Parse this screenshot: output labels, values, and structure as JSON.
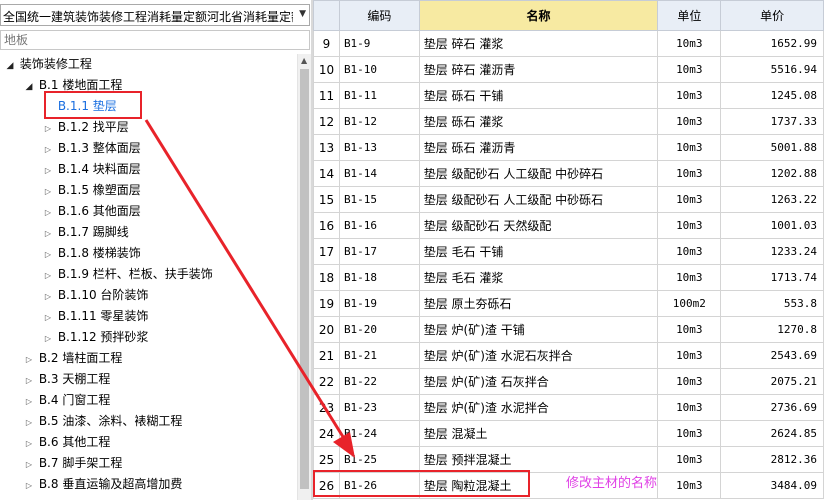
{
  "quota_library": "全国统一建筑装饰装修工程消耗量定额河北省消耗量定额",
  "search": {
    "placeholder": "地板"
  },
  "tree": [
    {
      "label": "装饰装修工程",
      "expanded": true
    },
    {
      "label": "B.1  楼地面工程",
      "expanded": true
    },
    {
      "label": "B.1.1  垫层",
      "selected": true
    },
    {
      "label": "B.1.2  找平层"
    },
    {
      "label": "B.1.3  整体面层"
    },
    {
      "label": "B.1.4  块料面层"
    },
    {
      "label": "B.1.5  橡塑面层"
    },
    {
      "label": "B.1.6  其他面层"
    },
    {
      "label": "B.1.7  踢脚线"
    },
    {
      "label": "B.1.8  楼梯装饰"
    },
    {
      "label": "B.1.9  栏杆、栏板、扶手装饰"
    },
    {
      "label": "B.1.10  台阶装饰"
    },
    {
      "label": "B.1.11  零星装饰"
    },
    {
      "label": "B.1.12  预拌砂浆"
    },
    {
      "label": "B.2  墙柱面工程"
    },
    {
      "label": "B.3  天棚工程"
    },
    {
      "label": "B.4  门窗工程"
    },
    {
      "label": "B.5  油漆、涂料、裱糊工程"
    },
    {
      "label": "B.6  其他工程"
    },
    {
      "label": "B.7  脚手架工程"
    },
    {
      "label": "B.8  垂直运输及超高增加费"
    }
  ],
  "table": {
    "headers": {
      "num": "",
      "code": "编码",
      "name": "名称",
      "unit": "单位",
      "price": "单价"
    },
    "rows": [
      {
        "n": "9",
        "code": "B1-9",
        "name": "垫层 碎石 灌浆",
        "unit": "10m3",
        "price": "1652.99"
      },
      {
        "n": "10",
        "code": "B1-10",
        "name": "垫层 碎石 灌沥青",
        "unit": "10m3",
        "price": "5516.94"
      },
      {
        "n": "11",
        "code": "B1-11",
        "name": "垫层 砾石 干铺",
        "unit": "10m3",
        "price": "1245.08"
      },
      {
        "n": "12",
        "code": "B1-12",
        "name": "垫层 砾石 灌浆",
        "unit": "10m3",
        "price": "1737.33"
      },
      {
        "n": "13",
        "code": "B1-13",
        "name": "垫层 砾石 灌沥青",
        "unit": "10m3",
        "price": "5001.88"
      },
      {
        "n": "14",
        "code": "B1-14",
        "name": "垫层 级配砂石 人工级配 中砂碎石",
        "unit": "10m3",
        "price": "1202.88"
      },
      {
        "n": "15",
        "code": "B1-15",
        "name": "垫层 级配砂石 人工级配 中砂砾石",
        "unit": "10m3",
        "price": "1263.22"
      },
      {
        "n": "16",
        "code": "B1-16",
        "name": "垫层 级配砂石 天然级配",
        "unit": "10m3",
        "price": "1001.03"
      },
      {
        "n": "17",
        "code": "B1-17",
        "name": "垫层 毛石 干铺",
        "unit": "10m3",
        "price": "1233.24"
      },
      {
        "n": "18",
        "code": "B1-18",
        "name": "垫层 毛石 灌浆",
        "unit": "10m3",
        "price": "1713.74"
      },
      {
        "n": "19",
        "code": "B1-19",
        "name": "垫层 原土夯砾石",
        "unit": "100m2",
        "price": "553.8"
      },
      {
        "n": "20",
        "code": "B1-20",
        "name": "垫层 炉(矿)渣 干铺",
        "unit": "10m3",
        "price": "1270.8"
      },
      {
        "n": "21",
        "code": "B1-21",
        "name": "垫层 炉(矿)渣 水泥石灰拌合",
        "unit": "10m3",
        "price": "2543.69"
      },
      {
        "n": "22",
        "code": "B1-22",
        "name": "垫层 炉(矿)渣 石灰拌合",
        "unit": "10m3",
        "price": "2075.21"
      },
      {
        "n": "23",
        "code": "B1-23",
        "name": "垫层 炉(矿)渣 水泥拌合",
        "unit": "10m3",
        "price": "2736.69"
      },
      {
        "n": "24",
        "code": "B1-24",
        "name": "垫层 混凝土",
        "unit": "10m3",
        "price": "2624.85"
      },
      {
        "n": "25",
        "code": "B1-25",
        "name": "垫层 预拌混凝土",
        "unit": "10m3",
        "price": "2812.36"
      },
      {
        "n": "26",
        "code": "B1-26",
        "name": "垫层 陶粒混凝土",
        "unit": "10m3",
        "price": "3484.09"
      }
    ]
  },
  "annotation": {
    "note": "修改主材的名称",
    "color": "#e8232a",
    "note_color": "#e040e6"
  }
}
